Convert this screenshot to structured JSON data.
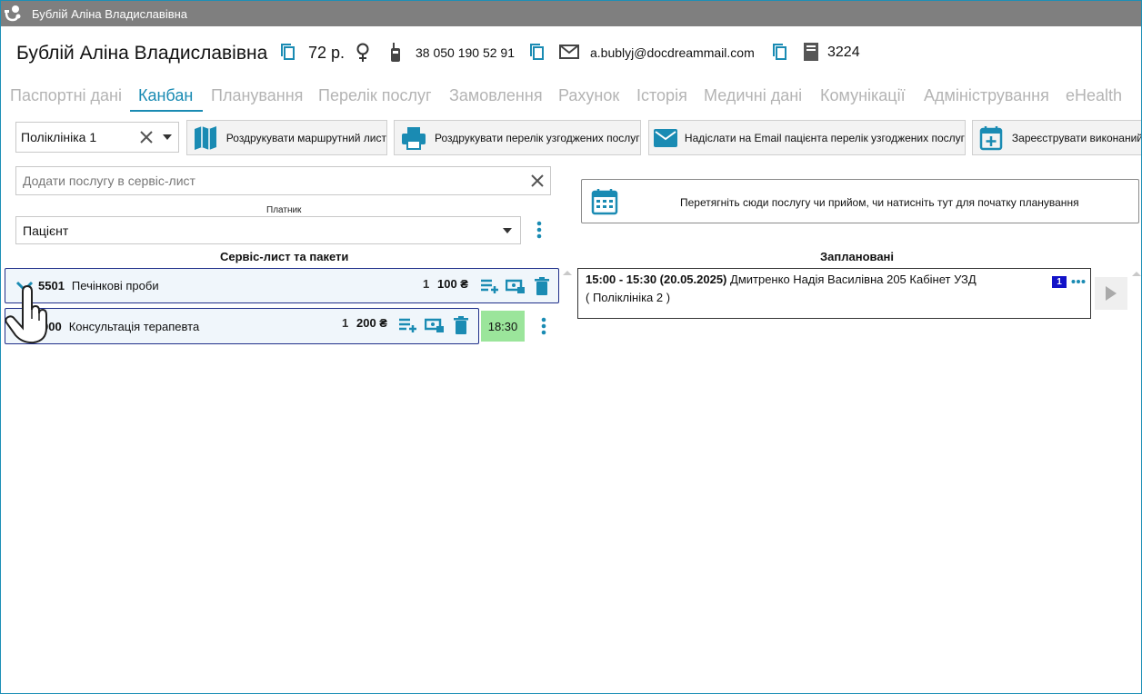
{
  "window": {
    "title": "Бублій Аліна Владиславівна"
  },
  "patient": {
    "name": "Бублій Аліна Владиславівна",
    "age": "72 р.",
    "phone": "38 050 190 52 91",
    "email": "a.bublyj@docdreammail.com",
    "card_number": "3224"
  },
  "tabs": [
    "Паспортні дані",
    "Канбан",
    "Планування",
    "Перелік послуг",
    "Замовлення",
    "Рахунок",
    "Історія",
    "Медичні дані",
    "Комунікації",
    "Адміністрування",
    "eHealth"
  ],
  "active_tab": "Канбан",
  "toolbar": {
    "clinic": "Поліклініка 1",
    "print_route": "Роздрукувати маршрутний лист",
    "print_services": "Роздрукувати перелік узгоджених послуг",
    "email_services": "Надіслати на Email пацієнта перелік узгоджених послуг",
    "register_done": "Зареєструвати виконаний"
  },
  "left": {
    "search_placeholder": "Додати послугу в сервіс-лист",
    "payer_label": "Платник",
    "payer_value": "Пацієнт",
    "section_title": "Сервіс-лист та пакети",
    "services": [
      {
        "code": "5501",
        "name": "Печінкові проби",
        "qty": "1",
        "price": "100 ₴"
      },
      {
        "code": "000",
        "name": "Консультація терапевта",
        "qty": "1",
        "price": "200 ₴",
        "time": "18:30"
      }
    ]
  },
  "right": {
    "planning_hint": "Перетягніть сюди послугу чи прийом, чи натисніть тут для початку планування",
    "section_title": "Заплановані",
    "appointment": {
      "time": "15:00 - 15:30 (20.05.2025)",
      "details": "Дмитренко Надія Василівна 205 Кабінет УЗД",
      "clinic": "( Поліклініка 2 )",
      "badge": "1"
    }
  },
  "colors": {
    "accent": "#1a8bb3",
    "titlebar": "#7f7f7f",
    "time_badge": "#9be59b",
    "row_border": "#1f2f8a"
  }
}
